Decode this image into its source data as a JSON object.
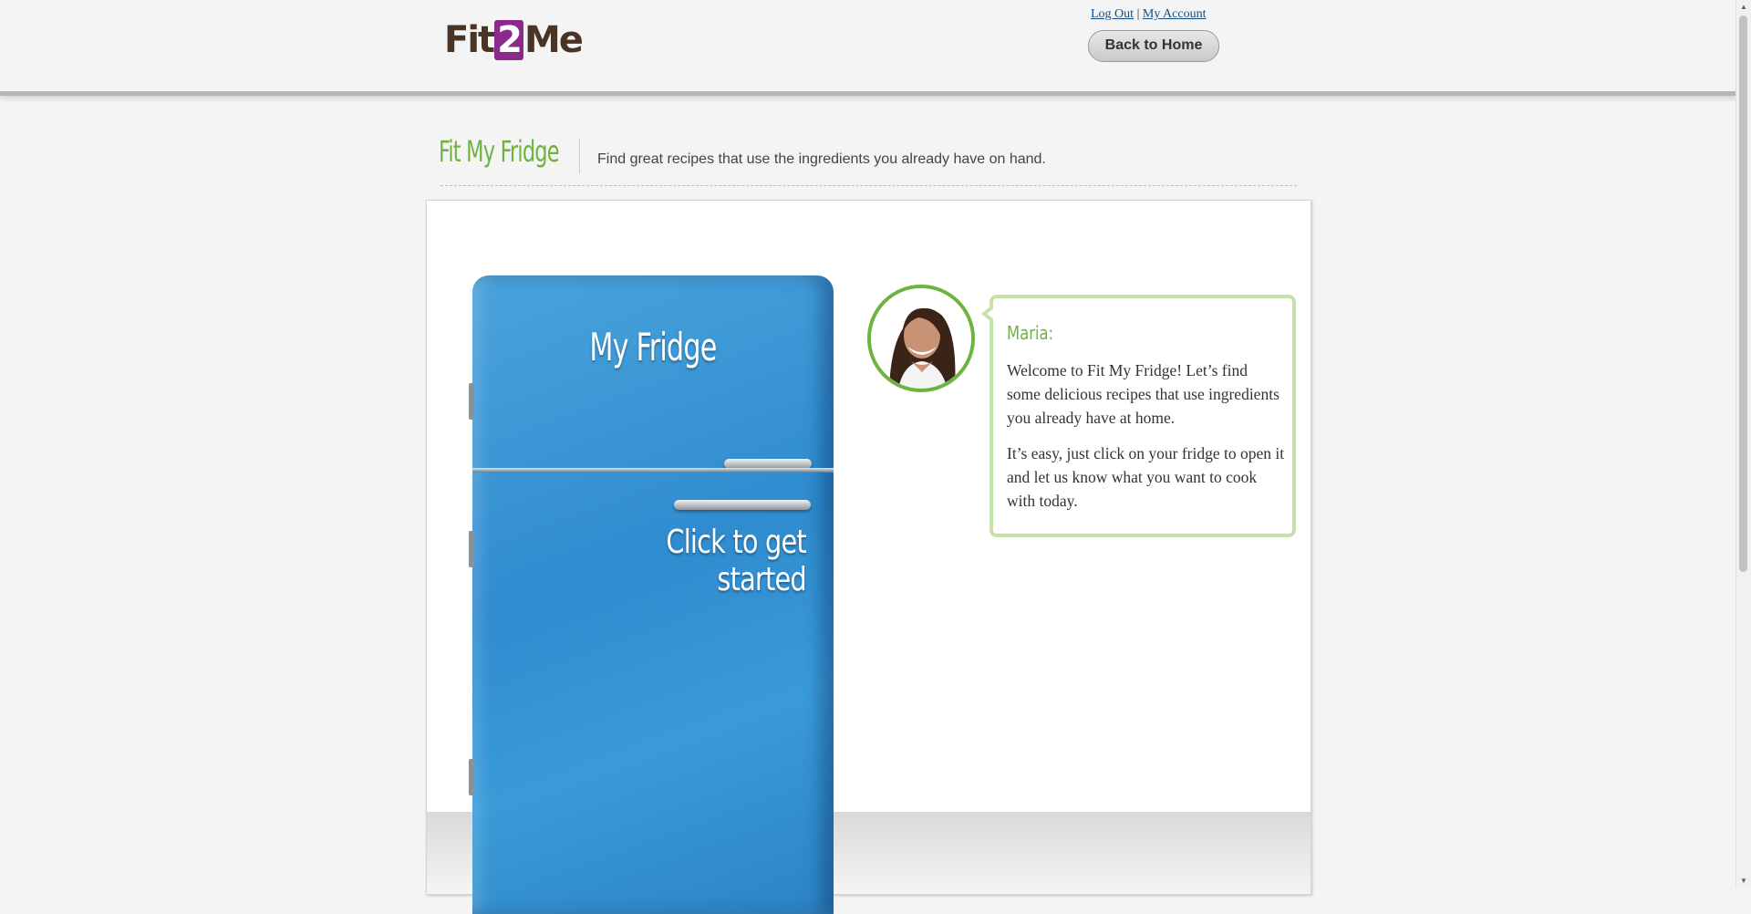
{
  "header": {
    "logo_text_a": "Fit",
    "logo_text_b": "2",
    "logo_text_c": "Me",
    "logout_link": "Log Out",
    "separator": "|",
    "account_link": "My Account",
    "back_button": "Back to Home"
  },
  "section": {
    "title": "Fit My Fridge",
    "subtitle": "Find great recipes that use the ingredients you already have on hand."
  },
  "fridge": {
    "title": "My Fridge",
    "cta_line1": "Click to get",
    "cta_line2": "started"
  },
  "guide": {
    "speaker": "Maria:",
    "message1": "Welcome to Fit My Fridge! Let’s find some delicious recipes that use ingredients you already have at home.",
    "message2": "It’s easy, just click on your fridge to open it and let us know what you want to cook with today."
  },
  "colors": {
    "brand_green": "#6db33f",
    "fridge_blue": "#3a9ad8",
    "logo_purple": "#8b2a8a",
    "logo_brown": "#4a3425"
  },
  "icons": {
    "scroll_up": "scroll-up-arrow-icon",
    "scroll_down": "scroll-down-arrow-icon"
  }
}
